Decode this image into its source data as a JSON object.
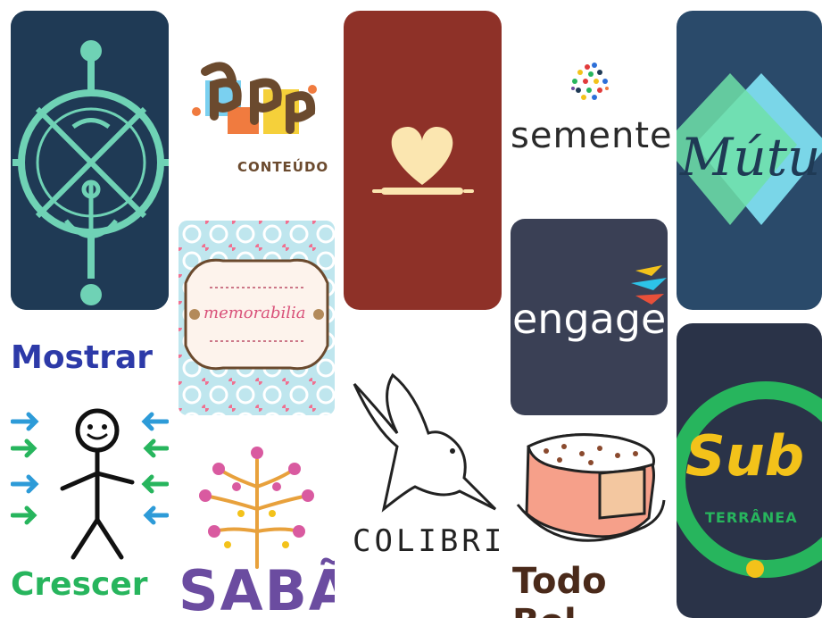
{
  "logos": {
    "ppp": {
      "caption": "CONTEÚDO",
      "letters": "PPP"
    },
    "memorabilia": {
      "label": "memorabilia"
    },
    "semente": {
      "label": "semente"
    },
    "engage": {
      "label": "engage"
    },
    "mutua": {
      "label": "Mútua"
    },
    "mostrar": {
      "top_word": "Mostrar",
      "bottom_word": "Crescer"
    },
    "sabao": {
      "label": "SABÃ"
    },
    "colibri": {
      "label": "COLIBRII"
    },
    "todo_bolo": {
      "label": "Todo Bol"
    },
    "sub": {
      "label": "Sub",
      "sublabel": "TERRÂNEA"
    }
  },
  "colors": {
    "navy": "#1f3a55",
    "teal": "#6fd2b5",
    "dark_red": "#8e3128",
    "cream": "#fbe6b0",
    "slate": "#3a4055",
    "green": "#27b55d",
    "yellow": "#f3c21a",
    "purple": "#6b4ca0",
    "orange": "#e8a13c"
  },
  "icons": [
    "ships-wheel-icon",
    "heart-rolling-pin-icon",
    "hummingbird-icon",
    "cake-icon",
    "stick-figure-icon",
    "tree-icon",
    "seed-dots-icon",
    "arrows-icon"
  ]
}
